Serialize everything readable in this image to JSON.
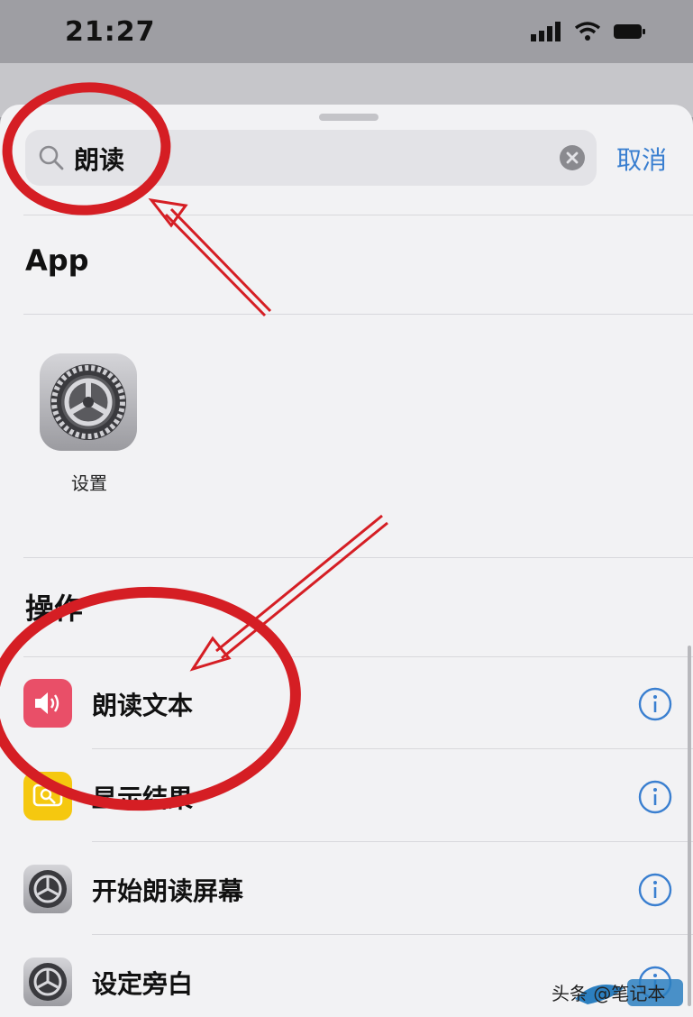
{
  "status_bar": {
    "time": "21:27"
  },
  "search": {
    "query": "朗读",
    "cancel_label": "取消"
  },
  "sections": {
    "apps_title": "App",
    "actions_title": "操作"
  },
  "apps": [
    {
      "label": "设置",
      "icon": "settings-gear-icon"
    }
  ],
  "actions": [
    {
      "label": "朗读文本",
      "icon": "speaker-icon",
      "color": "#e94f68"
    },
    {
      "label": "显示结果",
      "icon": "quick-look-icon",
      "color": "#f5c80f"
    },
    {
      "label": "开始朗读屏幕",
      "icon": "settings-gear-icon",
      "color": "#8e8e93"
    },
    {
      "label": "设定旁白",
      "icon": "settings-gear-icon",
      "color": "#8e8e93"
    }
  ],
  "annotation_color": "#d51e24",
  "watermark": {
    "text": "头条 @笔记本"
  }
}
